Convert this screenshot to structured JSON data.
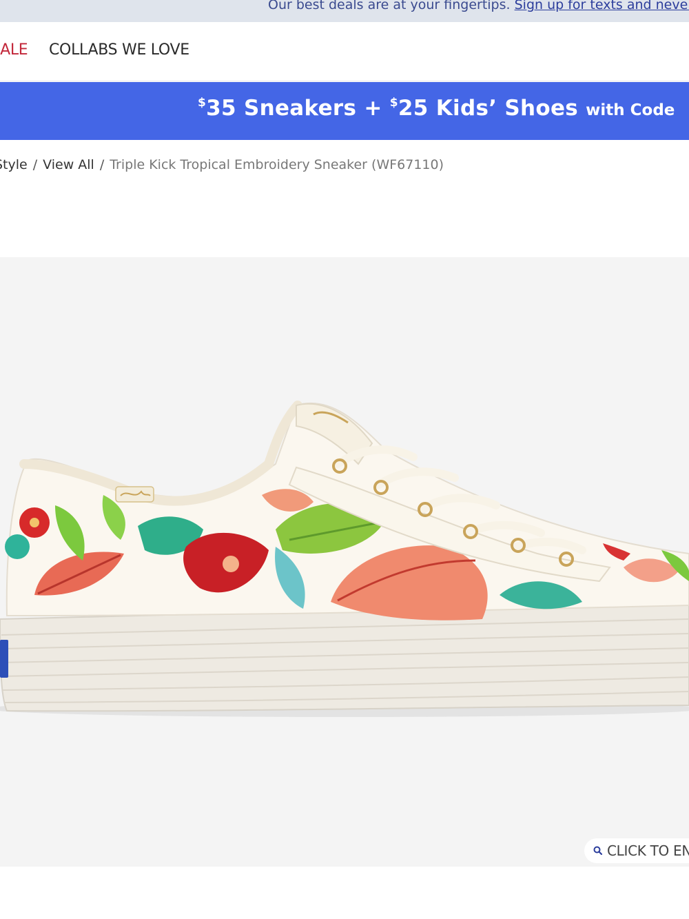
{
  "announcement": {
    "text": "Our best deals are at your fingertips.",
    "link": "Sign up for texts and never"
  },
  "nav": {
    "items": [
      "SALE",
      "COLLABS WE LOVE"
    ]
  },
  "promo": {
    "currency1": "$",
    "amount1": "35 Sneakers + ",
    "currency2": "$",
    "amount2": "25 Kids’ Shoes ",
    "suffix": "with Code"
  },
  "breadcrumb": {
    "items": [
      "Style",
      "View All"
    ],
    "current": "Triple Kick Tropical Embroidery Sneaker (WF67110)"
  },
  "gallery": {
    "zoom_label": "CLICK TO ENLARGE"
  },
  "colors": {
    "promo_bg": "#4466e6",
    "sale_red": "#c2273a",
    "announcement_bg": "#dfe4ec"
  }
}
